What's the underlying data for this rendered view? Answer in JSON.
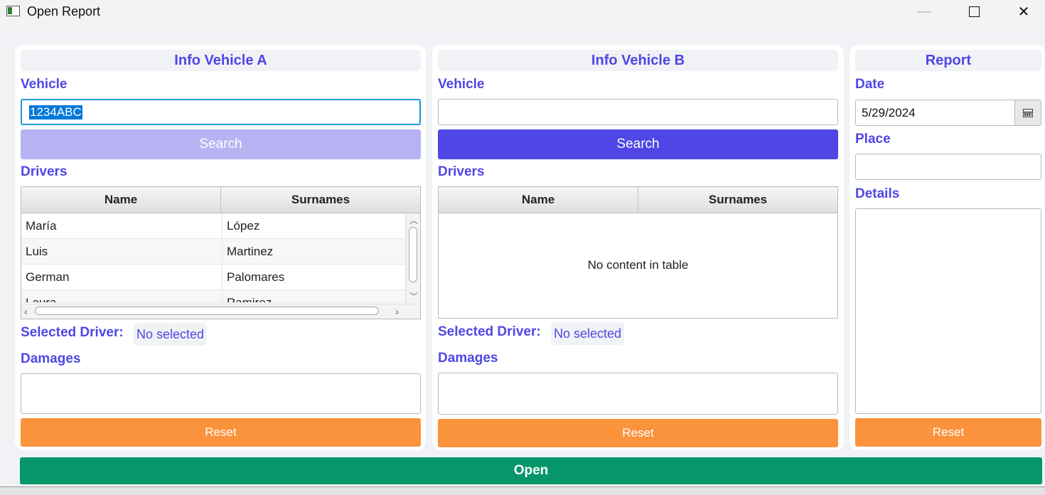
{
  "window": {
    "title": "Open Report",
    "controls": {
      "minimize": "—",
      "close": "✕"
    }
  },
  "vehicle_a": {
    "header": "Info Vehicle A",
    "vehicle_label": "Vehicle",
    "vehicle_value": "1234ABC",
    "search_label": "Search",
    "search_enabled": false,
    "drivers_label": "Drivers",
    "columns": [
      "Name",
      "Surnames"
    ],
    "rows": [
      {
        "name": "María",
        "surnames": "López"
      },
      {
        "name": "Luis",
        "surnames": "Martinez"
      },
      {
        "name": "German",
        "surnames": "Palomares"
      },
      {
        "name": "Laura",
        "surnames": "Ramirez"
      }
    ],
    "selected_driver_label": "Selected Driver:",
    "selected_driver_value": "No selected",
    "damages_label": "Damages",
    "damages_value": "",
    "reset_label": "Reset"
  },
  "vehicle_b": {
    "header": "Info Vehicle B",
    "vehicle_label": "Vehicle",
    "vehicle_value": "",
    "search_label": "Search",
    "search_enabled": true,
    "drivers_label": "Drivers",
    "columns": [
      "Name",
      "Surnames"
    ],
    "empty_table_text": "No content in table",
    "selected_driver_label": "Selected Driver:",
    "selected_driver_value": "No selected",
    "damages_label": "Damages",
    "damages_value": "",
    "reset_label": "Reset"
  },
  "report": {
    "header": "Report",
    "date_label": "Date",
    "date_value": "5/29/2024",
    "place_label": "Place",
    "place_value": "",
    "details_label": "Details",
    "details_value": "",
    "reset_label": "Reset"
  },
  "open_label": "Open",
  "colors": {
    "accent": "#4f46e5",
    "accent_disabled": "#b7b3f3",
    "reset": "#fb923c",
    "open": "#059669",
    "focus_border": "#1b9ad6",
    "selection": "#0078d7"
  }
}
